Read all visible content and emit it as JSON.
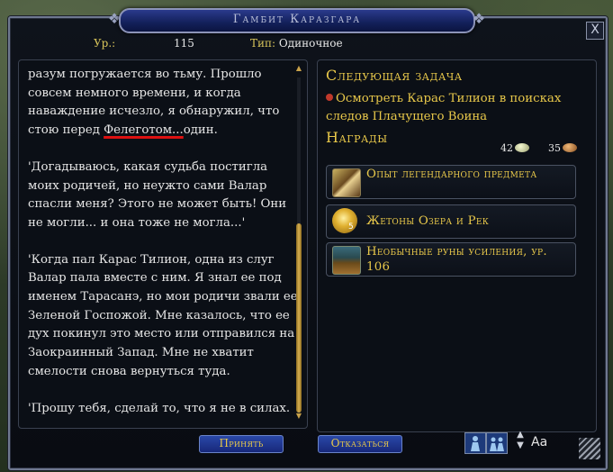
{
  "window": {
    "title": "Гамбит Каразгара",
    "close_label": "X"
  },
  "info": {
    "level_label": "Ур.:",
    "level_value": "115",
    "type_label": "Тип:",
    "type_value": "Одиночное"
  },
  "description": {
    "p1_pre": "разум погружается во тьму. Прошло совсем немного времени, и когда наваждение исчезло, я обнаружил, что стою перед ",
    "p1_underlined": "Фелеготом...",
    "p1_post": "один.",
    "p2": "'Догадываюсь, какая судьба постигла моих родичей, но неужто сами Валар спасли меня? Этого не может быть! Они не могли... и она тоже не могла...'",
    "p3": "'Когда пал Карас Тилион, одна из слуг Валар пала вместе с ним. Я знал ее под именем Тарасанэ, но мои родичи звали ее Зеленой Госпожой. Мне казалось, что ее дух покинул это место или отправился на Заокраинный Запад. Мне не хватит смелости снова вернуться туда.",
    "p4": "'Прошу тебя, сделай то, что я не в силах."
  },
  "next_task": {
    "heading": "Следующая задача",
    "text": "Осмотреть Карас Тилион в поисках следов Плачущего Воина"
  },
  "rewards": {
    "heading": "Награды",
    "currency": [
      {
        "amount": "42",
        "color": "#cfd6a8"
      },
      {
        "amount": "35",
        "color": "#c98a4a"
      }
    ],
    "items": [
      {
        "label": "Опыт легендарного предмета",
        "icon": "legendary-weapon-icon"
      },
      {
        "label": "Жетоны Озера и Рек",
        "icon": "gold-token-icon",
        "count": "5"
      },
      {
        "label": "Необычные руны усиления, ур. 106",
        "icon": "treasure-chest-icon"
      }
    ]
  },
  "buttons": {
    "accept": "Принять",
    "decline": "Отказаться",
    "font_size": "Aa"
  }
}
